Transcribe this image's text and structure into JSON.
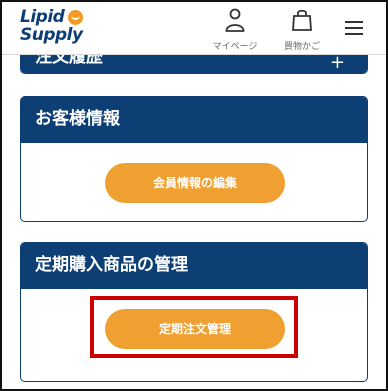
{
  "header": {
    "logo_line1": "Lipid",
    "logo_line2": "Supply",
    "mypage_label": "マイページ",
    "cart_label": "買物かご"
  },
  "sections": {
    "order_history": {
      "title": "注文履歴",
      "toggle": "+"
    },
    "customer_info": {
      "title": "お客様情報",
      "button": "会員情報の編集"
    },
    "subscription": {
      "title": "定期購入商品の管理",
      "button": "定期注文管理"
    }
  },
  "colors": {
    "navy": "#0d3f75",
    "orange": "#f0a030",
    "highlight": "#cc0000"
  }
}
